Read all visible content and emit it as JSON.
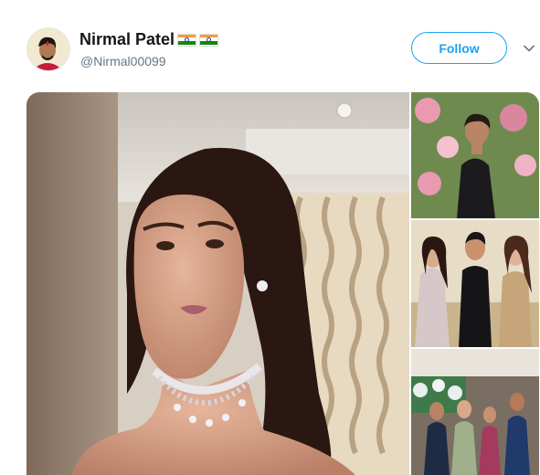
{
  "tweet": {
    "author": {
      "name": "Nirmal Patel",
      "handle": "@Nirmal00099",
      "flags": [
        "india-flag",
        "india-flag"
      ]
    },
    "follow_label": "Follow",
    "caret_icon": "chevron-down-icon",
    "media": {
      "photos": [
        {
          "name": "main-photo",
          "subject": "woman-with-diamond-choker"
        },
        {
          "name": "thumbnail-1",
          "subject": "man-in-black-suit"
        },
        {
          "name": "thumbnail-2",
          "subject": "group-of-three"
        },
        {
          "name": "thumbnail-3",
          "subject": "crowd-at-reception"
        }
      ]
    }
  },
  "colors": {
    "accent": "#1da1f2",
    "name_text": "#14171a",
    "secondary_text": "#657786",
    "flag_saffron": "#ff9933",
    "flag_green": "#138808",
    "flag_chakra": "#1a3f9c"
  }
}
